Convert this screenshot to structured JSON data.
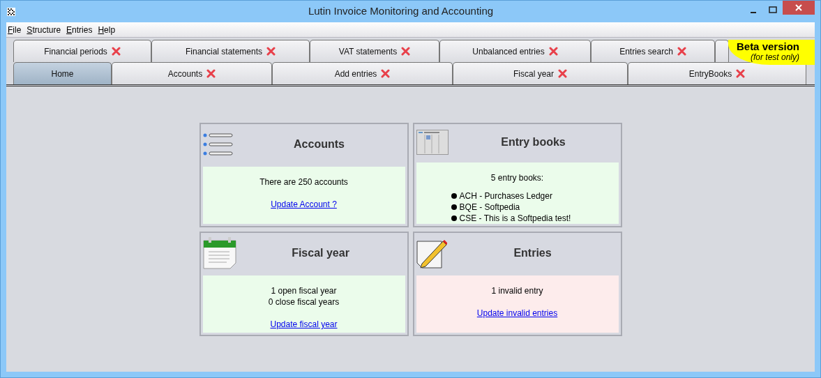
{
  "window": {
    "title": "Lutin Invoice Monitoring and Accounting"
  },
  "menu": [
    "File",
    "Structure",
    "Entries",
    "Help"
  ],
  "tab_rows": [
    [
      {
        "label": "Financial periods",
        "selected": false,
        "closable": true
      },
      {
        "label": "Financial statements",
        "selected": false,
        "closable": true
      },
      {
        "label": "VAT statements",
        "selected": false,
        "closable": true
      },
      {
        "label": "Unbalanced entries",
        "selected": false,
        "closable": true
      },
      {
        "label": "Entries search",
        "selected": false,
        "closable": true
      },
      {
        "selected": false,
        "closable": false
      }
    ],
    [
      {
        "label": "Home",
        "selected": true,
        "closable": false
      },
      {
        "label": "Accounts",
        "selected": false,
        "closable": true
      },
      {
        "label": "Add entries",
        "selected": false,
        "closable": true
      },
      {
        "label": "Fiscal year",
        "selected": false,
        "closable": true
      },
      {
        "label": "EntryBooks",
        "selected": false,
        "closable": true
      }
    ]
  ],
  "beta_banner": {
    "title": "Beta version",
    "subtitle": "(for test only)"
  },
  "cards": [
    {
      "title": "Accounts",
      "invalid": false,
      "lines": [
        "There are 250 accounts"
      ],
      "link": "Update Account ?"
    },
    {
      "title": "Entry books",
      "invalid": false,
      "lines": [
        "5 entry books:"
      ],
      "items": [
        "ACH - Purchases Ledger",
        "BQE - Softpedia",
        "CSE - This is a Softpedia test!"
      ]
    },
    {
      "title": "Fiscal year",
      "invalid": false,
      "lines": [
        "1 open fiscal year",
        "0 close fiscal years"
      ],
      "link": "Update fiscal year"
    },
    {
      "title": "Entries",
      "invalid": true,
      "lines": [
        "1 invalid entry"
      ],
      "link": "Update invalid entries"
    }
  ]
}
